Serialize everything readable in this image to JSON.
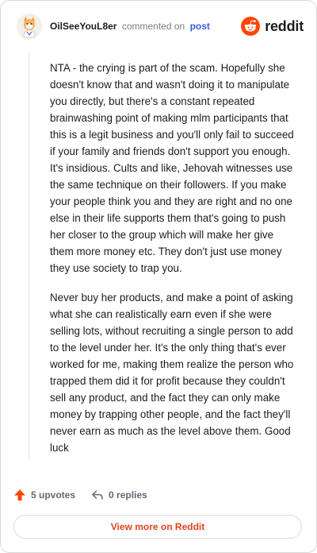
{
  "header": {
    "username": "OilSeeYouL8er",
    "commented_text": "commented on",
    "post_link": "post",
    "brand": "reddit"
  },
  "comment": {
    "paragraphs": [
      "NTA - the crying is part of the scam. Hopefully she doesn't know that and wasn't doing it to manipulate you directly, but there's a constant repeated brainwashing point of making mlm participants that this is a legit business and you'll only fail to succeed if your family and friends don't support you enough. It's insidious. Cults and like, Jehovah witnesses use the same technique on their followers. If you make your people think you and they are right and no one else in their life supports them that's going to push her closer to the group which will make her give them more money etc. They don't just use money they use society to trap you.",
      "Never buy her products, and make a point of asking what she can realistically earn even if she were selling lots, without recruiting a single person to add to the level under her. It's the only thing that's ever worked for me, making them realize the person who trapped them did it for profit because they couldn't sell any product, and the fact they can only make money by trapping other people, and the fact they'll never earn as much as the level above them. Good luck"
    ]
  },
  "actions": {
    "upvotes": "5 upvotes",
    "replies": "0 replies"
  },
  "footer": {
    "view_more": "View more on Reddit"
  },
  "colors": {
    "reddit_orange": "#ff4500",
    "link_blue": "#3b5bdb",
    "cta_text": "#e0431d",
    "upvote_icon": "#ff4500"
  },
  "icons": {
    "avatar": "user-avatar",
    "brand": "reddit-logo-icon",
    "upvote": "upvote-arrow-icon",
    "reply": "reply-arrow-icon"
  }
}
